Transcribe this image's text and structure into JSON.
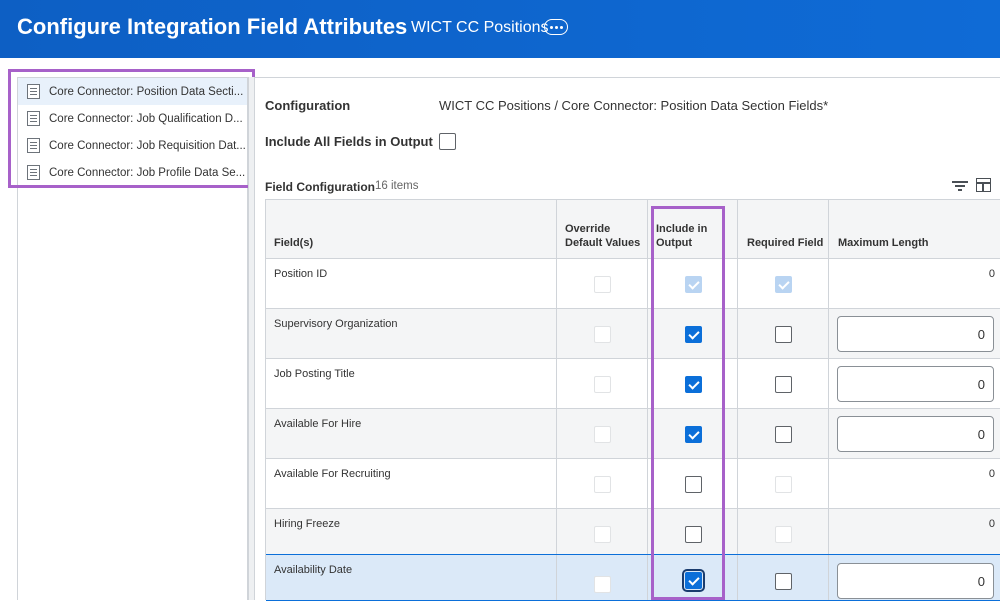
{
  "header": {
    "title": "Configure Integration Field Attributes",
    "subtitle": "WICT CC Positions",
    "more_icon": "ellipsis-icon"
  },
  "sidebar": {
    "items": [
      {
        "label": "Core Connector: Position Data Secti...",
        "icon": "document-icon",
        "active": true
      },
      {
        "label": "Core Connector: Job Qualification D...",
        "icon": "document-icon",
        "active": false
      },
      {
        "label": "Core Connector: Job Requisition Dat...",
        "icon": "document-icon",
        "active": false
      },
      {
        "label": "Core Connector: Job Profile Data Se...",
        "icon": "document-icon",
        "active": false
      }
    ]
  },
  "main": {
    "configuration_label": "Configuration",
    "configuration_value": "WICT CC Positions / Core Connector: Position Data Section Fields*",
    "include_all_label": "Include All Fields in Output",
    "include_all_checked": false,
    "section_title": "Field Configuration",
    "section_count": "16 items"
  },
  "table": {
    "headers": {
      "field": "Field(s)",
      "override_line1": "Override",
      "override_line2": "Default Values",
      "include_line1": "Include in",
      "include_line2": "Output",
      "required": "Required Field",
      "maxlen": "Maximum Length"
    },
    "rows": [
      {
        "field": "Position ID",
        "include": "disabled-checked",
        "required": "disabled-checked",
        "maxlen": "0",
        "editable": false
      },
      {
        "field": "Supervisory Organization",
        "include": "checked",
        "required": "unchecked",
        "maxlen": "0",
        "editable": true
      },
      {
        "field": "Job Posting Title",
        "include": "checked",
        "required": "unchecked",
        "maxlen": "0",
        "editable": true
      },
      {
        "field": "Available For Hire",
        "include": "checked",
        "required": "unchecked",
        "maxlen": "0",
        "editable": true
      },
      {
        "field": "Available For Recruiting",
        "include": "unchecked",
        "required": "disabled",
        "maxlen": "0",
        "editable": false
      },
      {
        "field": "Hiring Freeze",
        "include": "unchecked",
        "required": "disabled",
        "maxlen": "0",
        "editable": false
      },
      {
        "field": "Availability Date",
        "include": "checked-focused",
        "required": "unchecked",
        "maxlen": "0",
        "editable": true
      }
    ]
  },
  "colors": {
    "header_bg": "#0d5fc4",
    "checkbox_blue": "#0b6fd9",
    "highlight": "#a761c9",
    "selected_row": "#dbe9f8"
  }
}
